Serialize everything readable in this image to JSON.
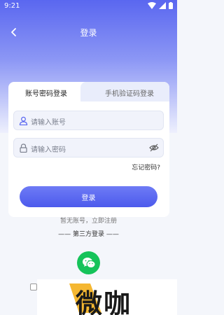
{
  "status_bar": {
    "time": "9:21"
  },
  "header": {
    "title": "登录"
  },
  "tabs": [
    {
      "label": "账号密码登录",
      "active": true
    },
    {
      "label": "手机验证码登录",
      "active": false
    }
  ],
  "form": {
    "account_placeholder": "请输入账号",
    "password_placeholder": "请输入密码",
    "forgot_label": "忘记密码?",
    "login_label": "登录",
    "register_label": "暂无账号，立即注册"
  },
  "third_party": {
    "label": "—— 第三方登录 ——",
    "icon": "wechat-icon"
  },
  "watermark": {
    "text": "微咖"
  },
  "colors": {
    "accent": "#5a67f0",
    "wechat": "#16c35a"
  }
}
